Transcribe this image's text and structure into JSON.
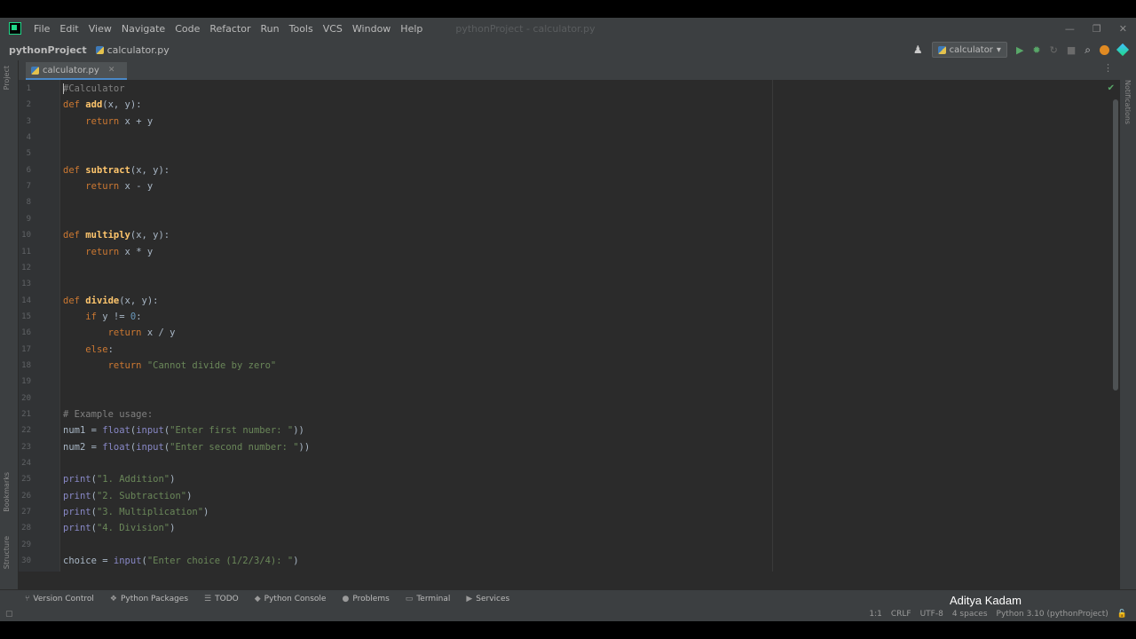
{
  "menubar": {
    "items": [
      "File",
      "Edit",
      "View",
      "Navigate",
      "Code",
      "Refactor",
      "Run",
      "Tools",
      "VCS",
      "Window",
      "Help"
    ],
    "title": "pythonProject - calculator.py",
    "minimize": "—",
    "restore": "❐",
    "close": "✕"
  },
  "navbar": {
    "project": "pythonProject",
    "file": "calculator.py",
    "run_config": "calculator"
  },
  "editor": {
    "tab_label": "calculator.py",
    "lines": [
      {
        "n": "1",
        "parts": [
          {
            "t": "#Calculator",
            "c": "cm"
          }
        ]
      },
      {
        "n": "2",
        "parts": [
          {
            "t": "def ",
            "c": "kw"
          },
          {
            "t": "add",
            "c": "fn"
          },
          {
            "t": "(x, y):",
            "c": "tx"
          }
        ]
      },
      {
        "n": "3",
        "parts": [
          {
            "t": "    ",
            "c": "tx"
          },
          {
            "t": "return",
            "c": "kw"
          },
          {
            "t": " x + y",
            "c": "tx"
          }
        ]
      },
      {
        "n": "4",
        "parts": []
      },
      {
        "n": "5",
        "parts": []
      },
      {
        "n": "6",
        "parts": [
          {
            "t": "def ",
            "c": "kw"
          },
          {
            "t": "subtract",
            "c": "fn"
          },
          {
            "t": "(x, y):",
            "c": "tx"
          }
        ]
      },
      {
        "n": "7",
        "parts": [
          {
            "t": "    ",
            "c": "tx"
          },
          {
            "t": "return",
            "c": "kw"
          },
          {
            "t": " x - y",
            "c": "tx"
          }
        ]
      },
      {
        "n": "8",
        "parts": []
      },
      {
        "n": "9",
        "parts": []
      },
      {
        "n": "10",
        "parts": [
          {
            "t": "def ",
            "c": "kw"
          },
          {
            "t": "multiply",
            "c": "fn"
          },
          {
            "t": "(x, y):",
            "c": "tx"
          }
        ]
      },
      {
        "n": "11",
        "parts": [
          {
            "t": "    ",
            "c": "tx"
          },
          {
            "t": "return",
            "c": "kw"
          },
          {
            "t": " x * y",
            "c": "tx"
          }
        ]
      },
      {
        "n": "12",
        "parts": []
      },
      {
        "n": "13",
        "parts": []
      },
      {
        "n": "14",
        "parts": [
          {
            "t": "def ",
            "c": "kw"
          },
          {
            "t": "divide",
            "c": "fn"
          },
          {
            "t": "(x, y):",
            "c": "tx"
          }
        ]
      },
      {
        "n": "15",
        "parts": [
          {
            "t": "    ",
            "c": "tx"
          },
          {
            "t": "if",
            "c": "kw"
          },
          {
            "t": " y != ",
            "c": "tx"
          },
          {
            "t": "0",
            "c": "num"
          },
          {
            "t": ":",
            "c": "tx"
          }
        ]
      },
      {
        "n": "16",
        "parts": [
          {
            "t": "        ",
            "c": "tx"
          },
          {
            "t": "return",
            "c": "kw"
          },
          {
            "t": " x / y",
            "c": "tx"
          }
        ]
      },
      {
        "n": "17",
        "parts": [
          {
            "t": "    ",
            "c": "tx"
          },
          {
            "t": "else",
            "c": "kw"
          },
          {
            "t": ":",
            "c": "tx"
          }
        ]
      },
      {
        "n": "18",
        "parts": [
          {
            "t": "        ",
            "c": "tx"
          },
          {
            "t": "return",
            "c": "kw"
          },
          {
            "t": " ",
            "c": "tx"
          },
          {
            "t": "\"Cannot divide by zero\"",
            "c": "str"
          }
        ]
      },
      {
        "n": "19",
        "parts": []
      },
      {
        "n": "20",
        "parts": []
      },
      {
        "n": "21",
        "parts": [
          {
            "t": "# Example usage:",
            "c": "cm"
          }
        ]
      },
      {
        "n": "22",
        "parts": [
          {
            "t": "num1 = ",
            "c": "tx"
          },
          {
            "t": "float",
            "c": "bi"
          },
          {
            "t": "(",
            "c": "tx"
          },
          {
            "t": "input",
            "c": "bi"
          },
          {
            "t": "(",
            "c": "tx"
          },
          {
            "t": "\"Enter first number: \"",
            "c": "str"
          },
          {
            "t": "))",
            "c": "tx"
          }
        ]
      },
      {
        "n": "23",
        "parts": [
          {
            "t": "num2 = ",
            "c": "tx"
          },
          {
            "t": "float",
            "c": "bi"
          },
          {
            "t": "(",
            "c": "tx"
          },
          {
            "t": "input",
            "c": "bi"
          },
          {
            "t": "(",
            "c": "tx"
          },
          {
            "t": "\"Enter second number: \"",
            "c": "str"
          },
          {
            "t": "))",
            "c": "tx"
          }
        ]
      },
      {
        "n": "24",
        "parts": []
      },
      {
        "n": "25",
        "parts": [
          {
            "t": "print",
            "c": "bi"
          },
          {
            "t": "(",
            "c": "tx"
          },
          {
            "t": "\"1. Addition\"",
            "c": "str"
          },
          {
            "t": ")",
            "c": "tx"
          }
        ]
      },
      {
        "n": "26",
        "parts": [
          {
            "t": "print",
            "c": "bi"
          },
          {
            "t": "(",
            "c": "tx"
          },
          {
            "t": "\"2. Subtraction\"",
            "c": "str"
          },
          {
            "t": ")",
            "c": "tx"
          }
        ]
      },
      {
        "n": "27",
        "parts": [
          {
            "t": "print",
            "c": "bi"
          },
          {
            "t": "(",
            "c": "tx"
          },
          {
            "t": "\"3. Multiplication\"",
            "c": "str"
          },
          {
            "t": ")",
            "c": "tx"
          }
        ]
      },
      {
        "n": "28",
        "parts": [
          {
            "t": "print",
            "c": "bi"
          },
          {
            "t": "(",
            "c": "tx"
          },
          {
            "t": "\"4. Division\"",
            "c": "str"
          },
          {
            "t": ")",
            "c": "tx"
          }
        ]
      },
      {
        "n": "29",
        "parts": []
      },
      {
        "n": "30",
        "parts": [
          {
            "t": "choice = ",
            "c": "tx"
          },
          {
            "t": "input",
            "c": "bi"
          },
          {
            "t": "(",
            "c": "tx"
          },
          {
            "t": "\"Enter choice (1/2/3/4): \"",
            "c": "str"
          },
          {
            "t": ")",
            "c": "tx"
          }
        ]
      }
    ]
  },
  "side_labels": {
    "project": "Project",
    "bookmarks": "Bookmarks",
    "structure": "Structure",
    "notifications": "Notifications"
  },
  "toolwindows": [
    "Version Control",
    "Python Packages",
    "TODO",
    "Python Console",
    "Problems",
    "Terminal",
    "Services"
  ],
  "watermark": "Aditya Kadam",
  "status": {
    "position": "1:1",
    "line_sep": "CRLF",
    "encoding": "UTF-8",
    "indent": "4 spaces",
    "interpreter": "Python 3.10 (pythonProject)"
  }
}
